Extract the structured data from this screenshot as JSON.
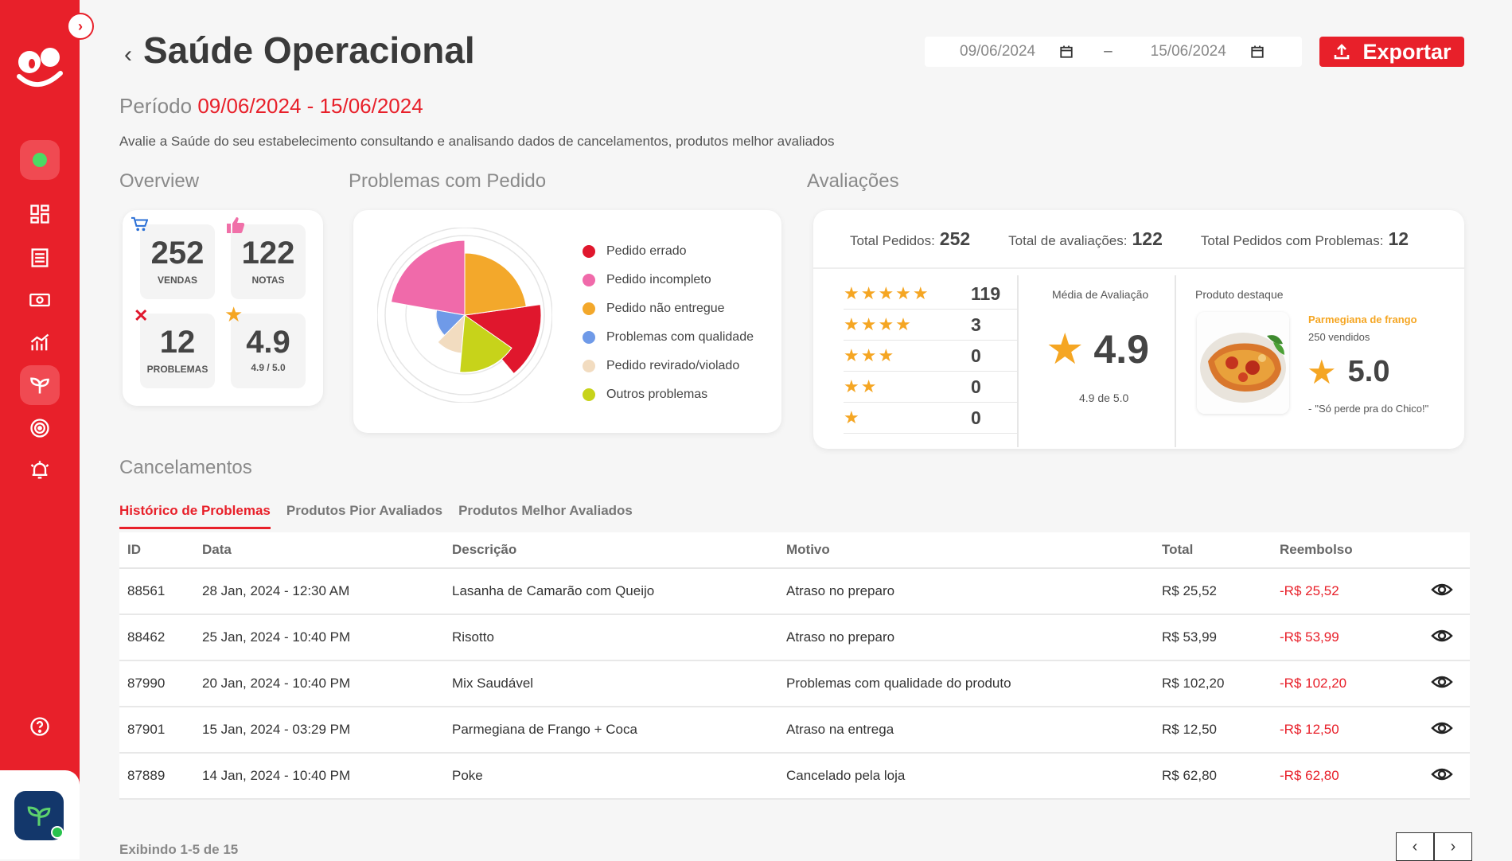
{
  "header": {
    "title": "Saúde Operacional",
    "period_label": "Período",
    "period_value": "09/06/2024 - 15/06/2024",
    "description": "Avalie a Saúde do seu estabelecimento consultando e analisando dados de cancelamentos, produtos melhor avaliados"
  },
  "date_range": {
    "start": "09/06/2024",
    "end": "15/06/2024",
    "separator": "–"
  },
  "export_label": "Exportar",
  "sections": {
    "overview": "Overview",
    "problems": "Problemas com Pedido",
    "ratings": "Avaliações",
    "cancellations": "Cancelamentos"
  },
  "overview": {
    "sales": {
      "value": "252",
      "label": "VENDAS"
    },
    "notes": {
      "value": "122",
      "label": "NOTAS"
    },
    "problems": {
      "value": "12",
      "label": "PROBLEMAS"
    },
    "rating": {
      "value": "4.9",
      "label": "4.9 / 5.0"
    }
  },
  "problems_legend": [
    {
      "label": "Pedido errado",
      "color": "#e0172d"
    },
    {
      "label": "Pedido incompleto",
      "color": "#f06aaa"
    },
    {
      "label": "Pedido não entregue",
      "color": "#f3a82b"
    },
    {
      "label": "Problemas com qualidade",
      "color": "#6f9ae8"
    },
    {
      "label": "Pedido revirado/violado",
      "color": "#f2dcc0"
    },
    {
      "label": "Outros problemas",
      "color": "#c7d31a"
    }
  ],
  "ratings": {
    "total_orders_label": "Total Pedidos:",
    "total_orders": "252",
    "total_ratings_label": "Total de avaliações:",
    "total_ratings": "122",
    "total_problems_label": "Total Pedidos com Problemas:",
    "total_problems": "12",
    "distribution": [
      {
        "stars": "★★★★★",
        "count": "119"
      },
      {
        "stars": "★★★★",
        "count": "3"
      },
      {
        "stars": "★★★",
        "count": "0"
      },
      {
        "stars": "★★",
        "count": "0"
      },
      {
        "stars": "★",
        "count": "0"
      }
    ],
    "average_label": "Média de Avaliação",
    "average": "4.9",
    "average_sub": "4.9 de 5.0",
    "featured_label": "Produto destaque",
    "featured_name": "Parmegiana de frango",
    "featured_sold": "250 vendidos",
    "featured_rating": "5.0",
    "featured_quote": "\"Só perde pra do Chico!\""
  },
  "tabs": [
    "Histórico de Problemas",
    "Produtos Pior Avaliados",
    "Produtos Melhor Avaliados"
  ],
  "table": {
    "headers": [
      "ID",
      "Data",
      "Descrição",
      "Motivo",
      "Total",
      "Reembolso"
    ],
    "rows": [
      [
        "88561",
        "28 Jan, 2024 - 12:30 AM",
        "Lasanha de Camarão com Queijo",
        "Atraso no preparo",
        "R$ 25,52",
        "-R$ 25,52"
      ],
      [
        "88462",
        "25 Jan, 2024 - 10:40 PM",
        "Risotto",
        "Atraso no preparo",
        "R$ 53,99",
        "-R$ 53,99"
      ],
      [
        "87990",
        "20 Jan, 2024 - 10:40 PM",
        "Mix Saudável",
        "Problemas com qualidade do produto",
        "R$ 102,20",
        "-R$ 102,20"
      ],
      [
        "87901",
        "15 Jan, 2024 - 03:29 PM",
        "Parmegiana de Frango + Coca",
        "Atraso na entrega",
        "R$ 12,50",
        "-R$ 12,50"
      ],
      [
        "87889",
        "14 Jan, 2024 - 10:40 PM",
        "Poke",
        "Cancelado pela loja",
        "R$ 62,80",
        "-R$ 62,80"
      ]
    ]
  },
  "pagination": {
    "showing": "Exibindo 1-5 de 15"
  }
}
